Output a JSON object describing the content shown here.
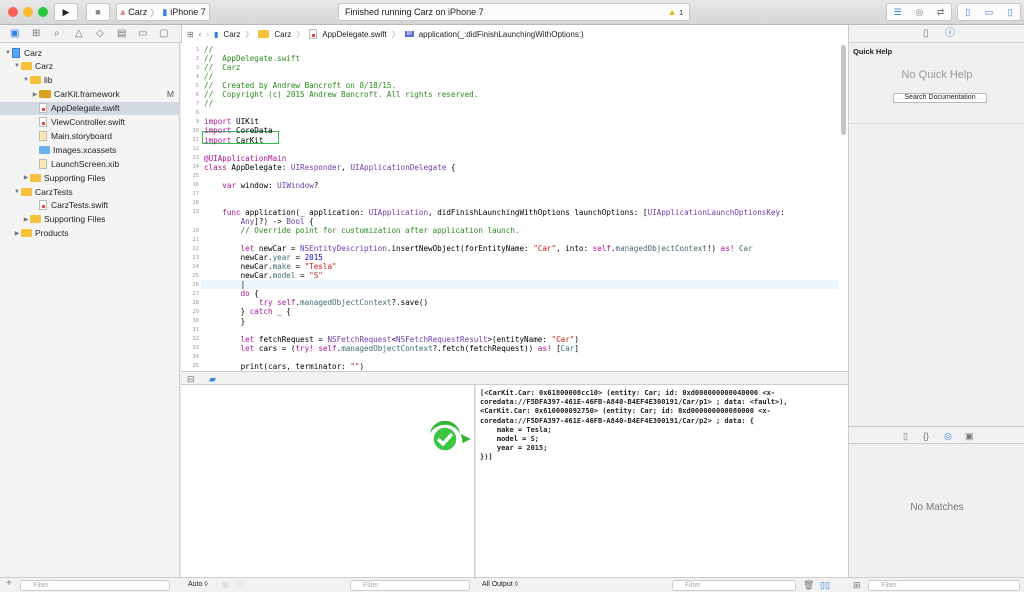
{
  "toolbar": {
    "scheme": "Carz",
    "device": "iPhone 7",
    "status": "Finished running Carz on iPhone 7",
    "warning_count": "1"
  },
  "jumpbar": [
    "Carz",
    "Carz",
    "AppDelegate.swift",
    "application(_:didFinishLaunchingWithOptions:)"
  ],
  "navigator": {
    "items": [
      {
        "label": "Carz",
        "depth": 0,
        "kind": "project",
        "open": true
      },
      {
        "label": "Carz",
        "depth": 1,
        "kind": "folder",
        "open": true
      },
      {
        "label": "lib",
        "depth": 2,
        "kind": "folder",
        "open": true
      },
      {
        "label": "CarKit.framework",
        "depth": 3,
        "kind": "framework",
        "badge": "M"
      },
      {
        "label": "AppDelegate.swift",
        "depth": 3,
        "kind": "swift",
        "selected": true
      },
      {
        "label": "ViewController.swift",
        "depth": 3,
        "kind": "swift"
      },
      {
        "label": "Main.storyboard",
        "depth": 3,
        "kind": "storyboard"
      },
      {
        "label": "Images.xcassets",
        "depth": 3,
        "kind": "assets"
      },
      {
        "label": "LaunchScreen.xib",
        "depth": 3,
        "kind": "xib"
      },
      {
        "label": "Supporting Files",
        "depth": 2,
        "kind": "folder",
        "open": false
      },
      {
        "label": "CarzTests",
        "depth": 1,
        "kind": "folder",
        "open": true
      },
      {
        "label": "CarzTests.swift",
        "depth": 3,
        "kind": "swift"
      },
      {
        "label": "Supporting Files",
        "depth": 2,
        "kind": "folder",
        "open": false
      },
      {
        "label": "Products",
        "depth": 1,
        "kind": "folder",
        "open": false
      }
    ]
  },
  "code": [
    {
      "n": "1",
      "t": [
        [
          "//",
          "c"
        ]
      ]
    },
    {
      "n": "2",
      "t": [
        [
          "//  AppDelegate.swift",
          "c"
        ]
      ]
    },
    {
      "n": "3",
      "t": [
        [
          "//  Carz",
          "c"
        ]
      ]
    },
    {
      "n": "4",
      "t": [
        [
          "//",
          "c"
        ]
      ]
    },
    {
      "n": "5",
      "t": [
        [
          "//  Created by Andrew Bancroft on 8/18/15.",
          "c"
        ]
      ]
    },
    {
      "n": "6",
      "t": [
        [
          "//  Copyright (c) 2015 Andrew Bancroft. All rights reserved.",
          "c"
        ]
      ]
    },
    {
      "n": "7",
      "t": [
        [
          "//",
          "c"
        ]
      ]
    },
    {
      "n": "8",
      "t": []
    },
    {
      "n": "9",
      "t": [
        [
          "import",
          "k"
        ],
        [
          " UIKit",
          ""
        ]
      ]
    },
    {
      "n": "10",
      "t": [
        [
          "import",
          "k"
        ],
        [
          " CoreData",
          ""
        ]
      ]
    },
    {
      "n": "11",
      "t": [
        [
          "import",
          "k"
        ],
        [
          " CarKit",
          ""
        ]
      ]
    },
    {
      "n": "12",
      "t": []
    },
    {
      "n": "13",
      "t": [
        [
          "@UIApplicationMain",
          "k"
        ]
      ]
    },
    {
      "n": "14",
      "t": [
        [
          "class",
          "k"
        ],
        [
          " AppDelegate: ",
          ""
        ],
        [
          "UIResponder",
          "t"
        ],
        [
          ", ",
          ""
        ],
        [
          "UIApplicationDelegate",
          "t"
        ],
        [
          " {",
          ""
        ]
      ]
    },
    {
      "n": "15",
      "t": []
    },
    {
      "n": "16",
      "t": [
        [
          "    ",
          ""
        ],
        [
          "var",
          "k"
        ],
        [
          " window: ",
          ""
        ],
        [
          "UIWindow",
          "t"
        ],
        [
          "?",
          ""
        ]
      ]
    },
    {
      "n": "17",
      "t": []
    },
    {
      "n": "18",
      "t": []
    },
    {
      "n": "19",
      "t": [
        [
          "    ",
          ""
        ],
        [
          "func",
          "k"
        ],
        [
          " application(_ application: ",
          ""
        ],
        [
          "UIApplication",
          "t"
        ],
        [
          ", didFinishLaunchingWithOptions launchOptions: [",
          ""
        ],
        [
          "UIApplicationLaunchOptionsKey",
          "t"
        ],
        [
          ":",
          ""
        ]
      ]
    },
    {
      "n": "",
      "t": [
        [
          "        ",
          ""
        ],
        [
          "Any",
          "t"
        ],
        [
          "]?) -> ",
          ""
        ],
        [
          "Bool",
          "t"
        ],
        [
          " {",
          ""
        ]
      ]
    },
    {
      "n": "20",
      "t": [
        [
          "        ",
          ""
        ],
        [
          "// Override point for customization after application launch.",
          "c"
        ]
      ]
    },
    {
      "n": "21",
      "t": []
    },
    {
      "n": "22",
      "t": [
        [
          "        ",
          ""
        ],
        [
          "let",
          "k"
        ],
        [
          " newCar = ",
          ""
        ],
        [
          "NSEntityDescription",
          "t"
        ],
        [
          ".insertNewObject(forEntityName: ",
          ""
        ],
        [
          "\"Car\"",
          "s"
        ],
        [
          ", into: ",
          ""
        ],
        [
          "self",
          "k"
        ],
        [
          ".",
          ""
        ],
        [
          "managedObjectContext",
          "p"
        ],
        [
          "!) ",
          ""
        ],
        [
          "as!",
          "k"
        ],
        [
          " ",
          ""
        ],
        [
          "Car",
          "p"
        ]
      ]
    },
    {
      "n": "23",
      "t": [
        [
          "        newCar.",
          ""
        ],
        [
          "year",
          "p"
        ],
        [
          " = ",
          ""
        ],
        [
          "2015",
          "n"
        ]
      ]
    },
    {
      "n": "24",
      "t": [
        [
          "        newCar.",
          ""
        ],
        [
          "make",
          "p"
        ],
        [
          " = ",
          ""
        ],
        [
          "\"Tesla\"",
          "s"
        ]
      ]
    },
    {
      "n": "25",
      "t": [
        [
          "        newCar.",
          ""
        ],
        [
          "model",
          "p"
        ],
        [
          " = ",
          ""
        ],
        [
          "\"S\"",
          "s"
        ]
      ]
    },
    {
      "n": "26",
      "t": [
        [
          "        |",
          ""
        ]
      ]
    },
    {
      "n": "27",
      "t": [
        [
          "        ",
          ""
        ],
        [
          "do",
          "k"
        ],
        [
          " {",
          ""
        ]
      ]
    },
    {
      "n": "28",
      "t": [
        [
          "            ",
          ""
        ],
        [
          "try",
          "k"
        ],
        [
          " ",
          ""
        ],
        [
          "self",
          "k"
        ],
        [
          ".",
          ""
        ],
        [
          "managedObjectContext",
          "p"
        ],
        [
          "?.save()",
          ""
        ]
      ]
    },
    {
      "n": "29",
      "t": [
        [
          "        } ",
          ""
        ],
        [
          "catch",
          "k"
        ],
        [
          " _ {",
          ""
        ]
      ]
    },
    {
      "n": "30",
      "t": [
        [
          "        }",
          ""
        ]
      ]
    },
    {
      "n": "31",
      "t": []
    },
    {
      "n": "32",
      "t": [
        [
          "        ",
          ""
        ],
        [
          "let",
          "k"
        ],
        [
          " fetchRequest = ",
          ""
        ],
        [
          "NSFetchRequest",
          "t"
        ],
        [
          "<",
          ""
        ],
        [
          "NSFetchRequestResult",
          "t"
        ],
        [
          ">(entityName: ",
          ""
        ],
        [
          "\"Car\"",
          "s"
        ],
        [
          ")",
          ""
        ]
      ]
    },
    {
      "n": "33",
      "t": [
        [
          "        ",
          ""
        ],
        [
          "let",
          "k"
        ],
        [
          " cars = (",
          ""
        ],
        [
          "try!",
          "k"
        ],
        [
          " ",
          ""
        ],
        [
          "self",
          "k"
        ],
        [
          ".",
          ""
        ],
        [
          "managedObjectContext",
          "p"
        ],
        [
          "?.fetch(fetchRequest)) ",
          ""
        ],
        [
          "as!",
          "k"
        ],
        [
          " [",
          ""
        ],
        [
          "Car",
          "p"
        ],
        [
          "]",
          ""
        ]
      ]
    },
    {
      "n": "34",
      "t": []
    },
    {
      "n": "35",
      "t": [
        [
          "        print(cars, terminator: ",
          ""
        ],
        [
          "\"\"",
          "s"
        ],
        [
          ")",
          ""
        ]
      ]
    }
  ],
  "console": {
    "lines": [
      "[<CarKit.Car: 0x61800008cc10> (entity: Car; id: 0xd000000000040000 <x-",
      "coredata://F5DFA397-461E-46FB-A840-B4EF4E300191/Car/p1> ; data: <fault>),",
      "<CarKit.Car: 0x610000092750> (entity: Car; id: 0xd000000000080000 <x-",
      "coredata://F5DFA397-461E-46FB-A840-B4EF4E300191/Car/p2> ; data: {",
      "    make = Tesla;",
      "    model = S;",
      "    year = 2015;",
      "})]"
    ]
  },
  "inspector": {
    "title": "Quick Help",
    "empty": "No Quick Help",
    "search_button": "Search Documentation",
    "library_empty": "No Matches"
  },
  "bottom": {
    "filter": "Filter",
    "auto": "Auto ◊",
    "all_output": "All Output ◊"
  },
  "colors": {
    "highlight_box": "#2ebd4e",
    "success_badge": "#35b53a",
    "accent": "#2d7fe0"
  }
}
